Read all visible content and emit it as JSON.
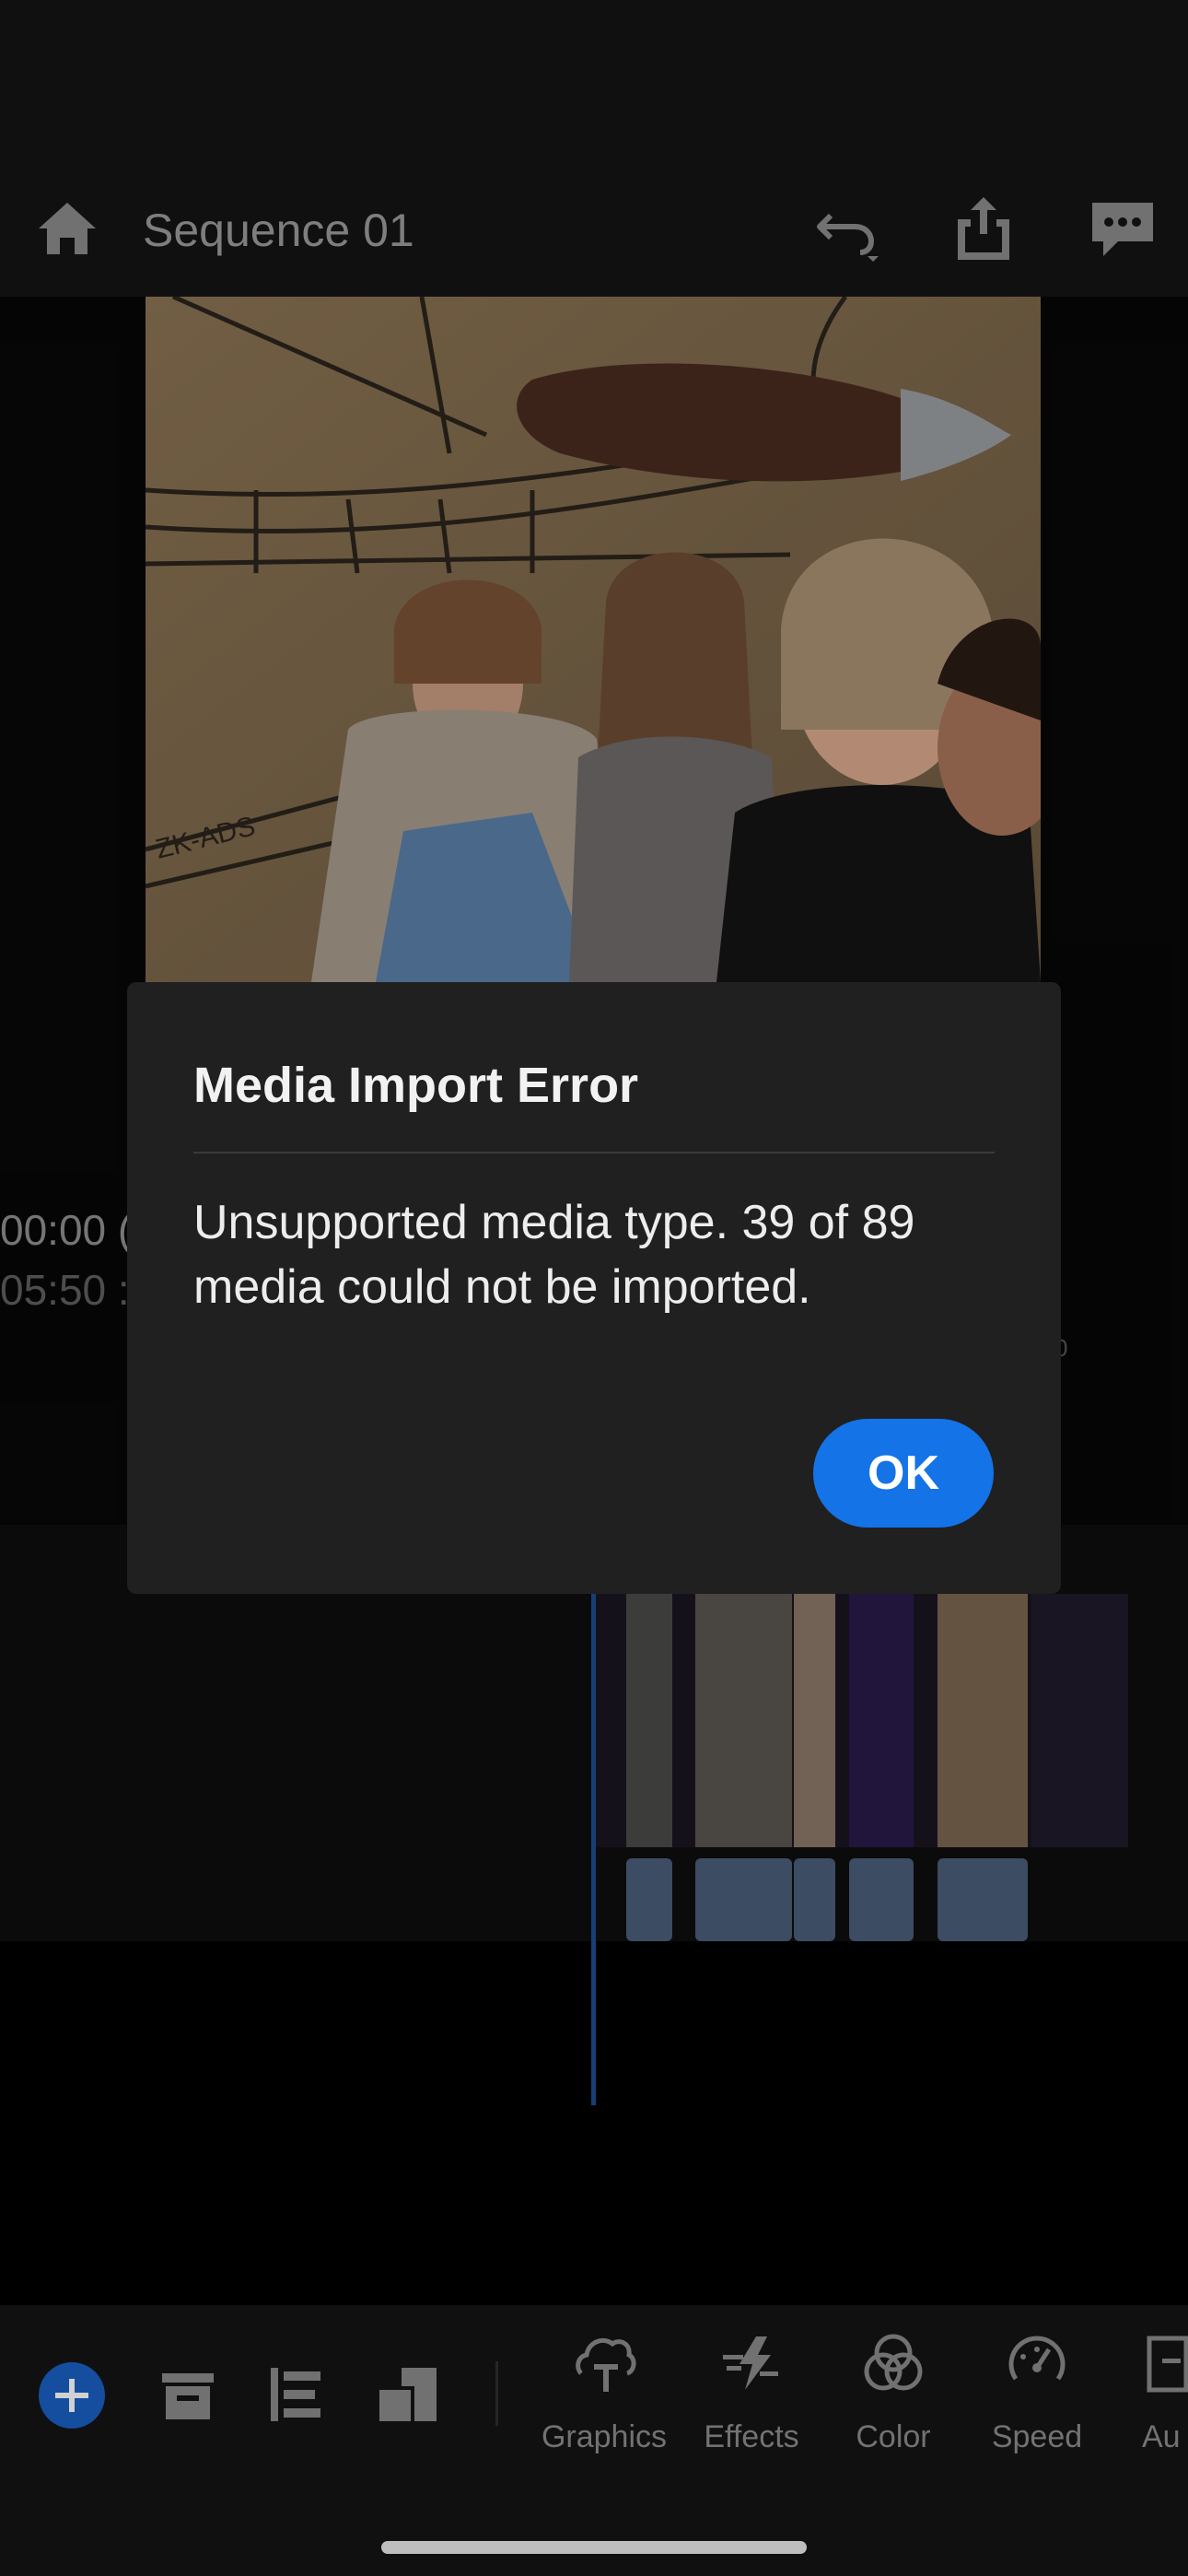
{
  "header": {
    "sequence_title": "Sequence 01",
    "icons": [
      "home-icon",
      "undo-icon",
      "share-icon",
      "comment-icon"
    ]
  },
  "monitor": {
    "timecode_current": "00:00 (",
    "timecode_total": "05:50 :",
    "ruler_fragment": "0"
  },
  "dialog": {
    "title": "Media Import Error",
    "message": "Unsupported media type. 39 of 89 media could not be imported.",
    "ok_label": "OK"
  },
  "toolbar": {
    "tools": [
      {
        "label": "Graphics",
        "icon": "graphics-icon"
      },
      {
        "label": "Effects",
        "icon": "effects-icon"
      },
      {
        "label": "Color",
        "icon": "color-icon"
      },
      {
        "label": "Speed",
        "icon": "speed-icon"
      },
      {
        "label": "Au",
        "icon": "audio-icon"
      }
    ]
  },
  "colors": {
    "accent": "#1473e6",
    "add_button": "#1a5fc2",
    "dialog_bg": "#202020"
  }
}
